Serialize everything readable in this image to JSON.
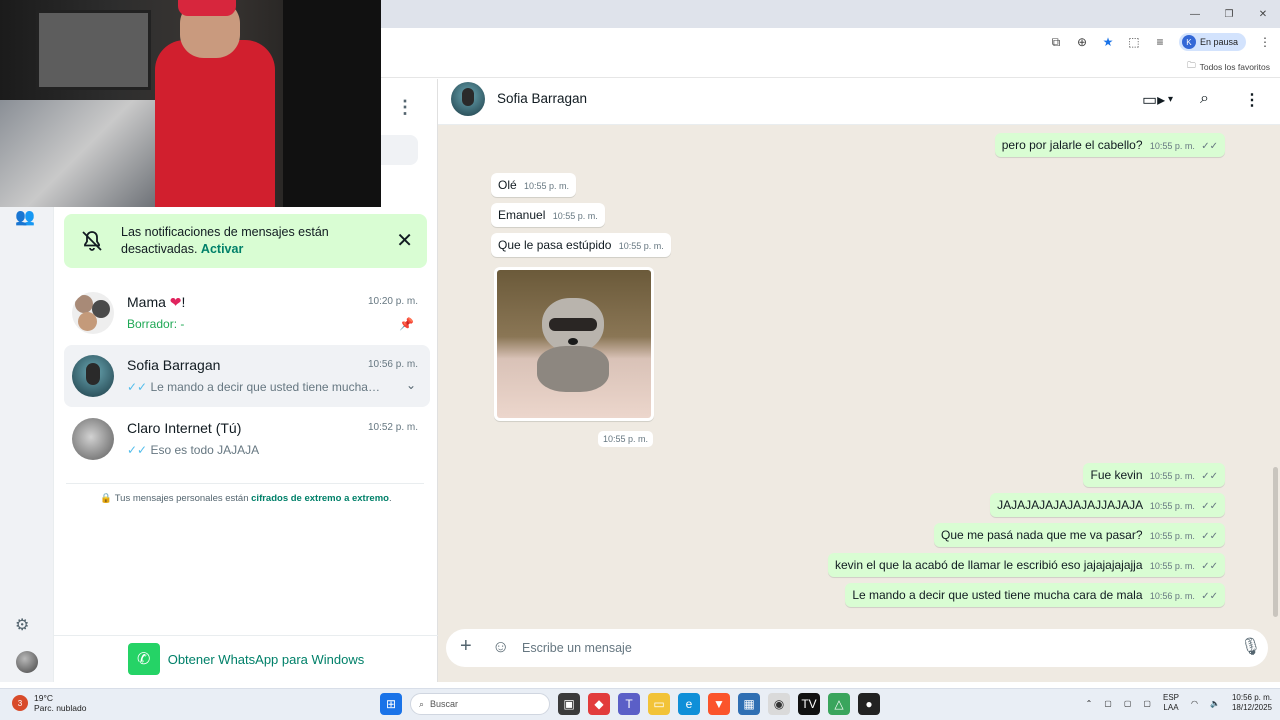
{
  "browser": {
    "profile_initial": "K",
    "profile_status": "En pausa",
    "bookmarks_all": "Todos los favoritos"
  },
  "notification_banner": {
    "text": "Las notificaciones de mensajes están desactivadas.",
    "action": "Activar"
  },
  "chats": [
    {
      "name": "Mama",
      "name_suffix": "!",
      "time": "10:20 p. m.",
      "draft_label": "Borrador:",
      "draft_text": " -"
    },
    {
      "name": "Sofia Barragan",
      "time": "10:56 p. m.",
      "ticks": "✓✓",
      "preview": "Le mando a decir que usted tiene mucha cara ..."
    },
    {
      "name": "Claro Internet",
      "name_suffix": "(Tú)",
      "time": "10:52 p. m.",
      "ticks": "✓✓",
      "preview": "Eso es todo JAJAJA"
    }
  ],
  "e2e_notice": {
    "text": "Tus mensajes personales están ",
    "link": "cifrados de extremo a extremo",
    "end": "."
  },
  "get_whatsapp": "Obtener WhatsApp para Windows",
  "conversation": {
    "contact_name": "Sofia Barragan",
    "messages": [
      {
        "dir": "out",
        "text": "pero por jalarle el cabello?",
        "time": "10:55 p. m.",
        "ticks": "✓✓"
      },
      {
        "dir": "in",
        "text": "Olé",
        "time": "10:55 p. m."
      },
      {
        "dir": "in",
        "text": "Emanuel",
        "time": "10:55 p. m."
      },
      {
        "dir": "in",
        "text": "Que le pasa estúpido",
        "time": "10:55 p. m."
      },
      {
        "dir": "in",
        "text": "",
        "time": "10:55 p. m.",
        "image": "raccoon-photo"
      },
      {
        "dir": "out",
        "text": "Fue kevin",
        "time": "10:55 p. m.",
        "ticks": "✓✓"
      },
      {
        "dir": "out",
        "text": "JAJAJAJAJAJAJAJJAJAJA",
        "time": "10:55 p. m.",
        "ticks": "✓✓"
      },
      {
        "dir": "out",
        "text": "Que me pasá nada que me va pasar?",
        "time": "10:55 p. m.",
        "ticks": "✓✓"
      },
      {
        "dir": "out",
        "text": "kevin el que la acabó de llamar le escribió eso jajajajajajja",
        "time": "10:55 p. m.",
        "ticks": "✓✓"
      },
      {
        "dir": "out",
        "text": "Le mando a decir que usted tiene mucha cara de mala",
        "time": "10:56 p. m.",
        "ticks": "✓✓"
      }
    ]
  },
  "composer": {
    "placeholder": "Escribe un mensaje"
  },
  "taskbar": {
    "temperature": "19°C",
    "weather": "Parc. nublado",
    "weather_badge": "3",
    "search": "Buscar",
    "lang_top": "ESP",
    "lang_bottom": "LAA",
    "time": "10:56 p. m.",
    "date": "18/12/2025"
  },
  "colors": {
    "wa_green": "#008069",
    "bubble_out": "#d9fdd3",
    "chat_bg": "#efeae2",
    "read_ticks": "#53bdeb"
  }
}
